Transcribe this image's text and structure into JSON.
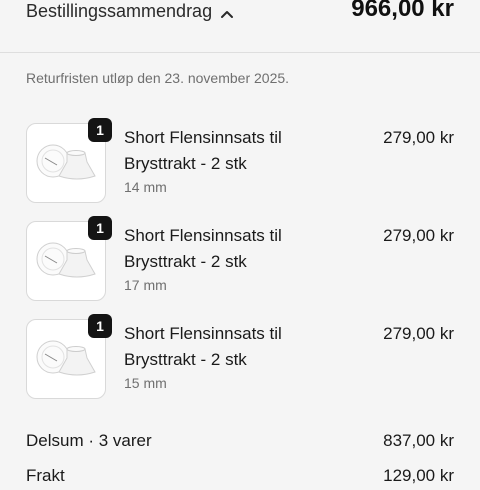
{
  "header": {
    "summary_label": "Bestillingssammendrag",
    "total": "966,00 kr"
  },
  "return_note": "Returfristen utløp den 23. november 2025.",
  "items": [
    {
      "quantity": "1",
      "name": "Short Flensinnsats til Brysttrakt - 2 stk",
      "variant": "14 mm",
      "price": "279,00 kr"
    },
    {
      "quantity": "1",
      "name": "Short Flensinnsats til Brysttrakt - 2 stk",
      "variant": "17 mm",
      "price": "279,00 kr"
    },
    {
      "quantity": "1",
      "name": "Short Flensinnsats til Brysttrakt - 2 stk",
      "variant": "15 mm",
      "price": "279,00 kr"
    }
  ],
  "totals": {
    "subtotal_label": "Delsum · 3 varer",
    "subtotal_value": "837,00 kr",
    "shipping_label": "Frakt",
    "shipping_value": "129,00 kr"
  }
}
